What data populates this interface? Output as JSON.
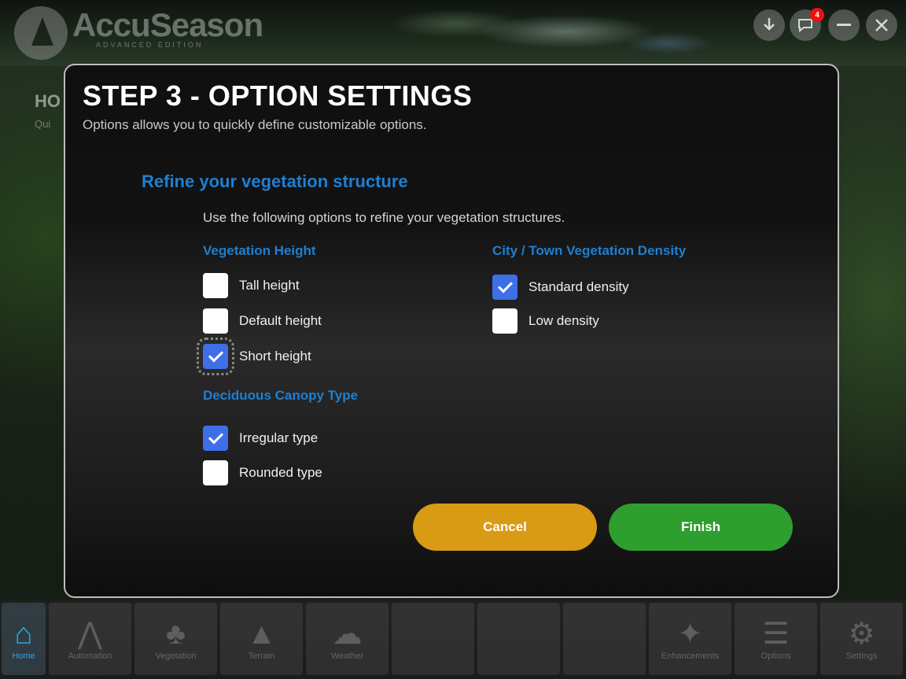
{
  "app": {
    "logo_name": "AccuSeason",
    "logo_sub": "ADVANCED EDITION",
    "notification_count": "4"
  },
  "window_controls": [
    "download-icon",
    "chat-icon",
    "minimize-icon",
    "close-icon"
  ],
  "background": {
    "home_title": "HO",
    "home_sub": "Qui"
  },
  "dialog": {
    "title": "STEP 3 - OPTION SETTINGS",
    "subtitle": "Options allows you to quickly define customizable options.",
    "section_title": "Refine your vegetation structure",
    "section_desc": "Use the following options to refine your vegetation structures.",
    "groups": {
      "height": {
        "title": "Vegetation Height",
        "options": [
          {
            "label": "Tall height",
            "checked": false
          },
          {
            "label": "Default height",
            "checked": false
          },
          {
            "label": "Short height",
            "checked": true,
            "focused": true
          }
        ]
      },
      "canopy": {
        "title": "Deciduous Canopy Type",
        "options": [
          {
            "label": "Irregular type",
            "checked": true
          },
          {
            "label": "Rounded type",
            "checked": false
          }
        ]
      },
      "density": {
        "title": "City / Town Vegetation Density",
        "options": [
          {
            "label": "Standard density",
            "checked": true
          },
          {
            "label": "Low density",
            "checked": false
          }
        ]
      }
    },
    "buttons": {
      "cancel": "Cancel",
      "finish": "Finish"
    },
    "colors": {
      "accent": "#1f7fd1",
      "checkbox": "#3f6fe8",
      "cancel": "#d99a14",
      "finish": "#2e9e2e"
    }
  },
  "bottom_nav": [
    {
      "label": "Home",
      "icon": "home-icon",
      "active": true
    },
    {
      "label": "Automation",
      "icon": "automation-icon"
    },
    {
      "label": "Vegetation",
      "icon": "tree-icon"
    },
    {
      "label": "Terrain",
      "icon": "mountain-icon"
    },
    {
      "label": "Weather",
      "icon": "weather-icon"
    },
    {
      "label": "",
      "icon": ""
    },
    {
      "label": "",
      "icon": ""
    },
    {
      "label": "",
      "icon": ""
    },
    {
      "label": "Enhancements",
      "icon": "magic-wand-icon"
    },
    {
      "label": "Options",
      "icon": "sliders-icon"
    },
    {
      "label": "Settings",
      "icon": "gear-icon"
    }
  ]
}
